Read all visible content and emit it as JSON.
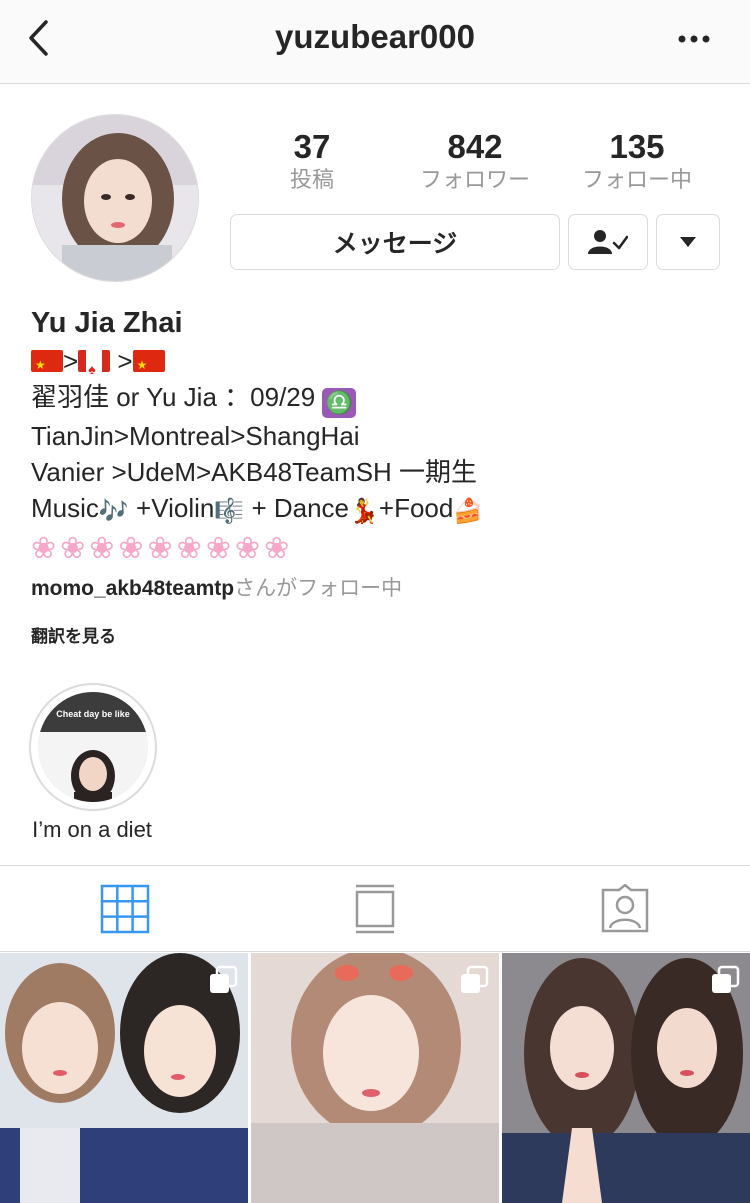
{
  "header": {
    "username": "yuzubear000",
    "back_icon": "chevron-left-icon",
    "more_icon": "ellipsis-icon"
  },
  "stats": {
    "posts": {
      "value": "37",
      "label": "投稿"
    },
    "followers": {
      "value": "842",
      "label": "フォロワー"
    },
    "following": {
      "value": "135",
      "label": "フォロー中"
    }
  },
  "actions": {
    "message_label": "メッセージ",
    "following_icon": "person-check-icon",
    "dropdown_icon": "caret-down-icon"
  },
  "bio": {
    "name": "Yu Jia Zhai",
    "sep1": ">",
    "sep2": " >",
    "line2": "翟羽佳 or Yu Jia ：09/29",
    "libra_glyph": "♎",
    "line3": "TianJin>Montreal>ShangHai",
    "line4": "Vanier >UdeM>AKB48TeamSH 一期生",
    "line5_music": "Music",
    "line5_music_emoji": "🎶",
    "line5_violin": " +Violin",
    "line5_violin_emoji": "🎼",
    "line5_dance": " + Dance",
    "line5_dance_emoji": "💃",
    "line5_food": "+Food",
    "line5_food_emoji": "🍰",
    "blossoms": "❀❀❀❀❀❀❀❀❀",
    "followed_by_user": "momo_akb48teamtp",
    "followed_by_suffix": "さんがフォロー中",
    "translate": "翻訳を見る"
  },
  "highlight": {
    "label": "I’m on a diet",
    "caption": "Cheat day be like"
  },
  "tabs": {
    "grid_icon": "grid-icon",
    "feed_icon": "feed-icon",
    "tagged_icon": "tagged-person-icon",
    "active_color": "#3897f0"
  },
  "posts": [
    {
      "kind": "carousel"
    },
    {
      "kind": "carousel"
    },
    {
      "kind": "carousel"
    }
  ]
}
